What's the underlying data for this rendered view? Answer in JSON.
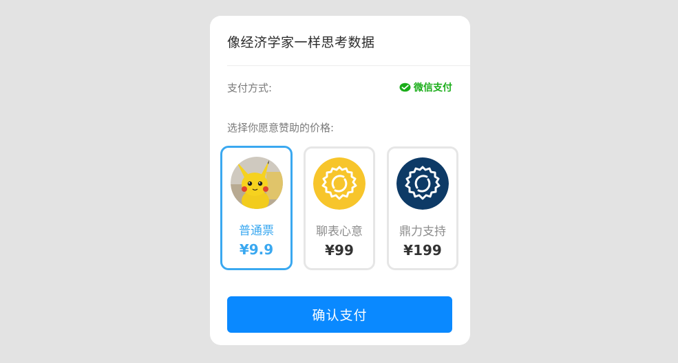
{
  "dialog": {
    "title": "像经济学家一样思考数据",
    "payment_method_label": "支付方式:",
    "payment_method_value": "微信支付",
    "price_prompt": "选择你愿意赞助的价格:",
    "confirm_label": "确认支付"
  },
  "options": [
    {
      "name": "普通票",
      "price": "¥9.9",
      "selected": true,
      "icon": "pikachu-avatar"
    },
    {
      "name": "聊表心意",
      "price": "¥99",
      "selected": false,
      "icon": "yellow-badge-icon"
    },
    {
      "name": "鼎力支持",
      "price": "¥199",
      "selected": false,
      "icon": "navy-badge-icon"
    }
  ],
  "colors": {
    "accent": "#3aa8f0",
    "button": "#0a89ff",
    "wechat_green": "#1aad19",
    "badge_yellow": "#f7c52b",
    "badge_navy": "#0d3a66"
  }
}
